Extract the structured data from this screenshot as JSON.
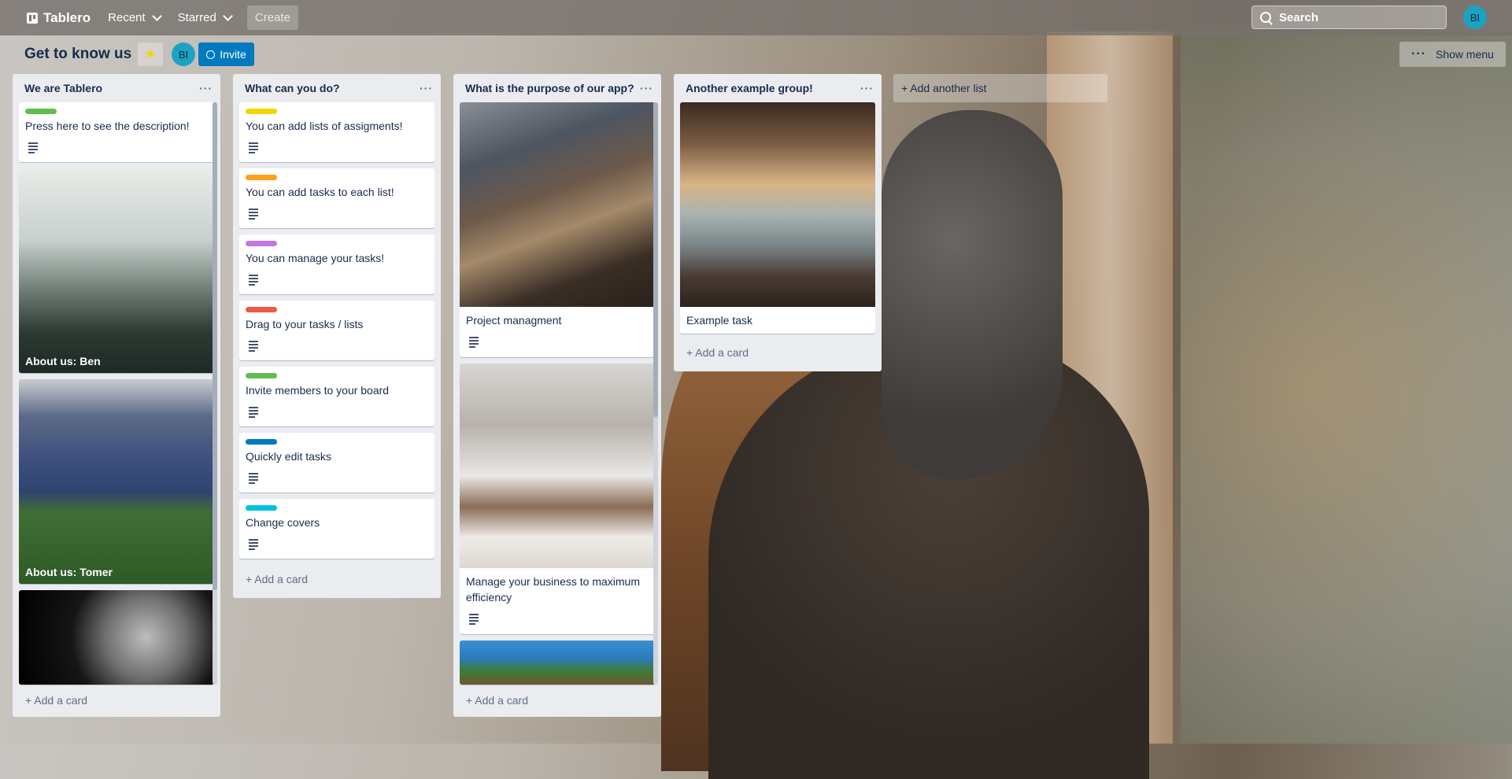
{
  "app": {
    "name": "Tablero"
  },
  "nav": {
    "recent": "Recent",
    "starred": "Starred",
    "create": "Create",
    "search_placeholder": "Search",
    "user_initials": "BI"
  },
  "board": {
    "title": "Get to know us",
    "member_initials": "BI",
    "invite": "Invite",
    "show_menu": "Show menu",
    "add_list": "+ Add another list"
  },
  "lists": [
    {
      "title": "We are Tablero",
      "menu": "···",
      "add_card": "+ Add a card",
      "cards": [
        {
          "text": "Press here to see the description!",
          "label_color": "#61bd4f"
        },
        {
          "caption": "About us: Ben"
        },
        {
          "caption": "About us: Tomer"
        },
        {
          "caption": ""
        }
      ]
    },
    {
      "title": "What can you do?",
      "menu": "···",
      "add_card": "+ Add a card",
      "cards": [
        {
          "text": "You can add lists of assigments!",
          "label_color": "#f2d600"
        },
        {
          "text": "You can add tasks to each list!",
          "label_color": "#ff9f1a"
        },
        {
          "text": "You can manage your tasks!",
          "label_color": "#c377e0"
        },
        {
          "text": "Drag to your tasks / lists",
          "label_color": "#eb5a46"
        },
        {
          "text": "Invite members to your board",
          "label_color": "#61bd4f"
        },
        {
          "text": "Quickly edit tasks",
          "label_color": "#0079bf"
        },
        {
          "text": "Change covers",
          "label_color": "#00c2e0"
        }
      ]
    },
    {
      "title": "What is the purpose of our app?",
      "menu": "···",
      "add_card": "+ Add a card",
      "cards": [
        {
          "text": "Project managment"
        },
        {
          "text": "Manage your business to maximum efficiency"
        },
        {
          "text": ""
        }
      ]
    },
    {
      "title": "Another example group!",
      "menu": "···",
      "add_card": "+ Add a card",
      "cards": [
        {
          "text": "Example task"
        }
      ]
    }
  ]
}
